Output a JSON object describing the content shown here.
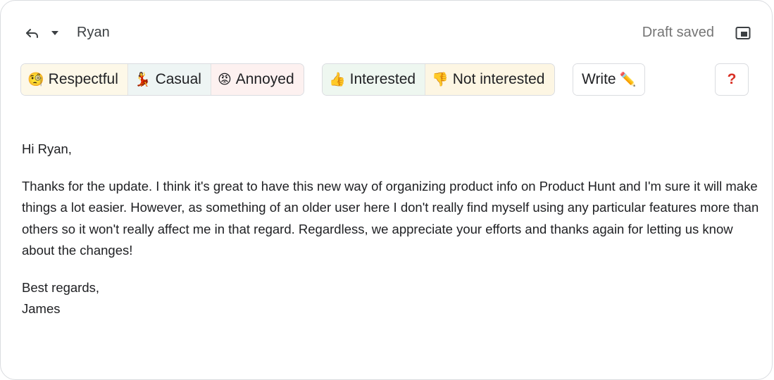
{
  "header": {
    "recipient": "Ryan",
    "status": "Draft saved",
    "icons": [
      "reply-icon",
      "chevron-down-icon",
      "popout-icon"
    ]
  },
  "tone_chips": [
    {
      "emoji": "🧐",
      "label": "Respectful",
      "bg": "#fdf8e8"
    },
    {
      "emoji": "💃",
      "label": "Casual",
      "bg": "#eef5f4"
    },
    {
      "emoji": "😡",
      "label": "Annoyed",
      "bg": "#fdf1f0"
    }
  ],
  "reply_chips": [
    {
      "emoji": "👍",
      "label": "Interested",
      "bg": "#eef7f0"
    },
    {
      "emoji": "👎",
      "label": "Not interested",
      "bg": "#fdf6e3"
    }
  ],
  "write_chip": {
    "label": "Write",
    "emoji": "✏️"
  },
  "help_label": "?",
  "colors": {
    "help_accent": "#d93025",
    "border": "#dadce0"
  },
  "email": {
    "greeting": "Hi Ryan,",
    "paragraph": "Thanks for the update. I think it's great to have this new way of organizing product info on Product Hunt and I'm sure it will make things a lot easier. However, as something of an older user here I don't really find myself using any particular features more than others so it won't really affect me in that regard. Regardless, we appreciate your efforts and thanks again for letting us know about the changes!",
    "closing": "Best regards,",
    "signature": "James"
  }
}
